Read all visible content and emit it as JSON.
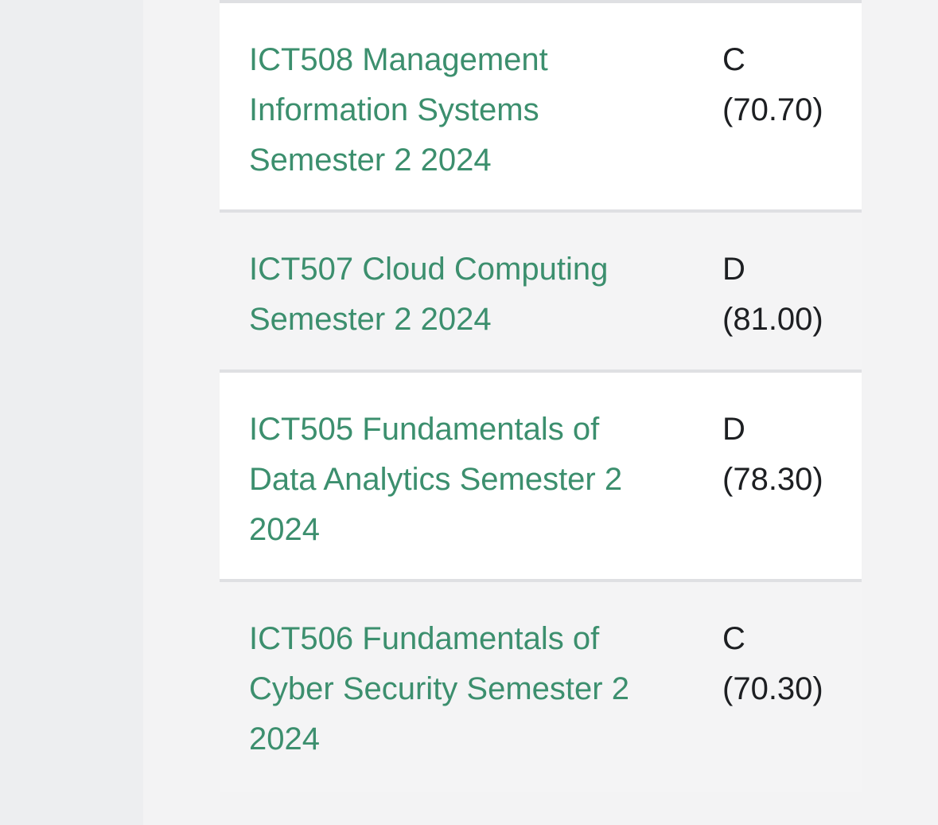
{
  "grades": [
    {
      "course": "ICT508 Management Information Systems Semester 2 2024",
      "grade": "C",
      "score": "(70.70)"
    },
    {
      "course": "ICT507 Cloud Computing Semester 2 2024",
      "grade": "D",
      "score": "(81.00)"
    },
    {
      "course": "ICT505 Fundamentals of Data Analytics Semester 2 2024",
      "grade": "D",
      "score": "(78.30)"
    },
    {
      "course": "ICT506 Fundamentals of Cyber Security Semester 2 2024",
      "grade": "C",
      "score": "(70.30)"
    }
  ],
  "colors": {
    "link": "#3c8f6e",
    "text": "#1d1f22",
    "row_odd": "#ffffff",
    "row_even": "#f4f4f5",
    "border": "#dfe0e3",
    "page_background": "#edeef0"
  }
}
